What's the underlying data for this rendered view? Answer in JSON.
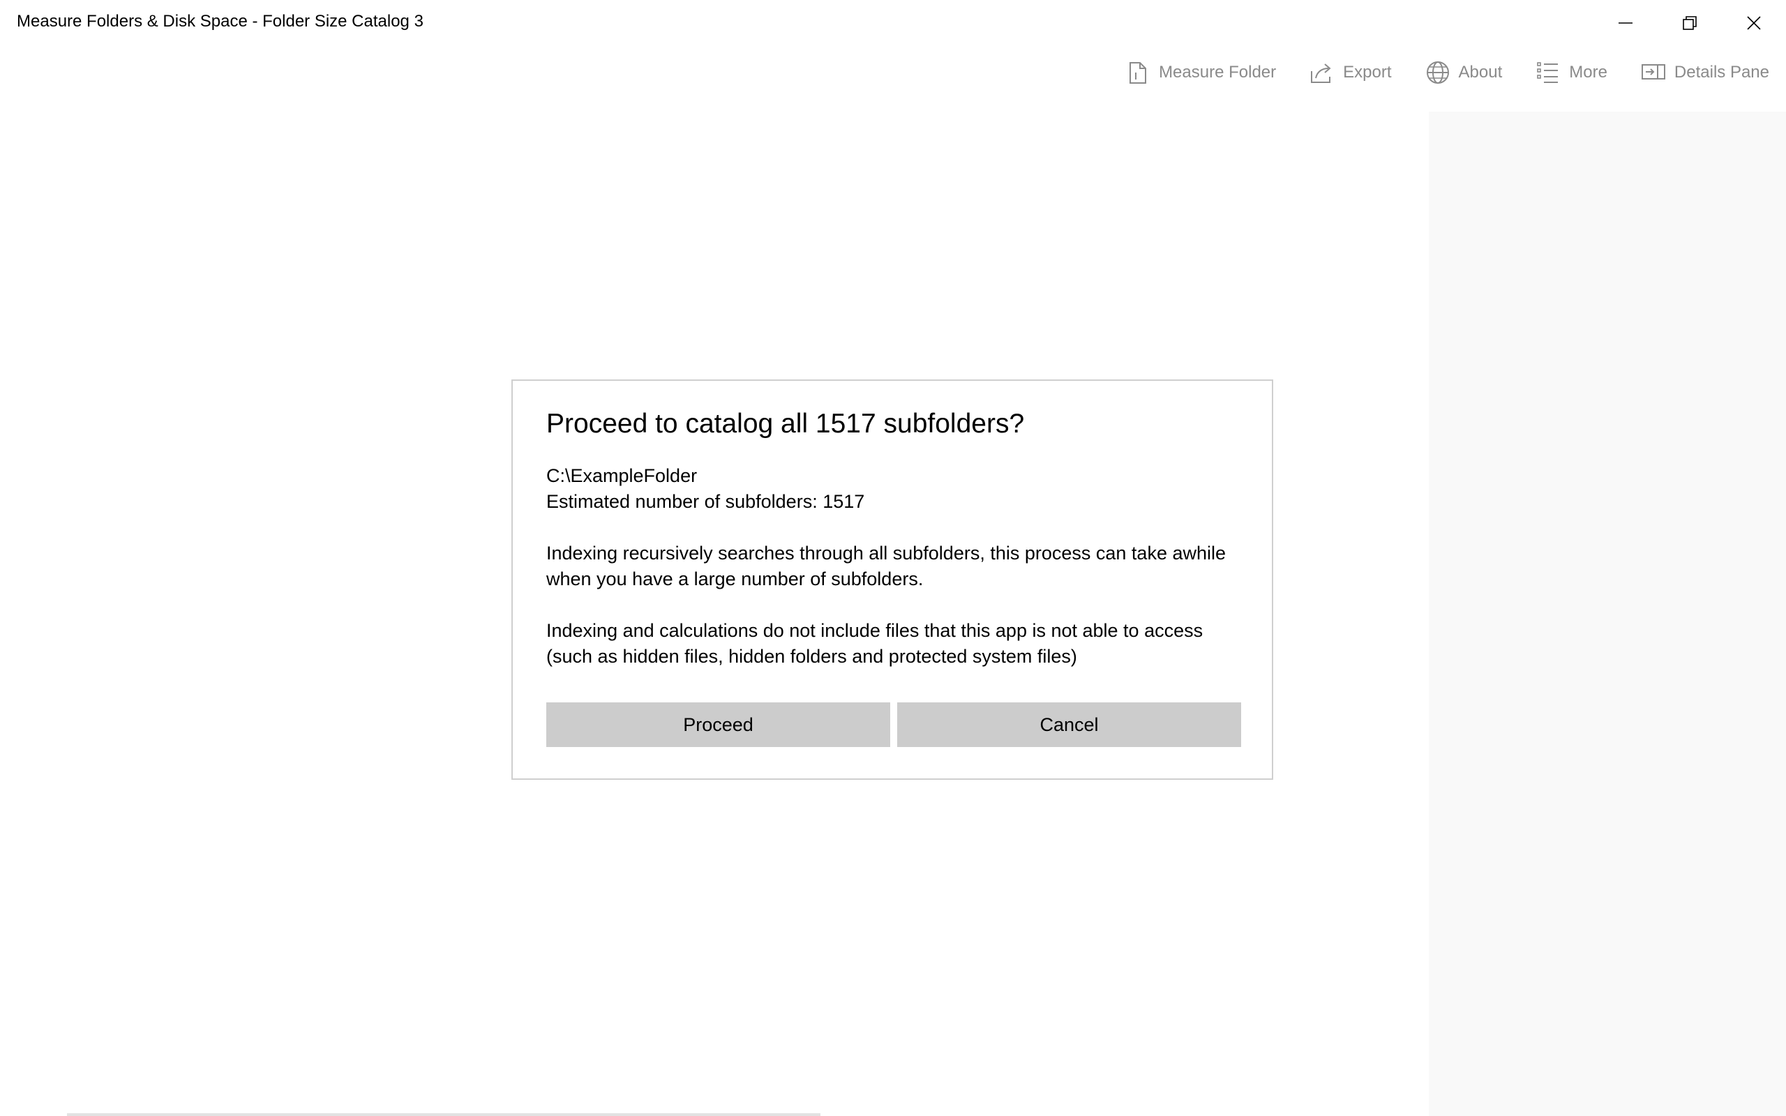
{
  "window": {
    "title": "Measure Folders & Disk Space - Folder Size Catalog 3"
  },
  "caption_buttons": {
    "minimize_icon": "minimize-icon",
    "restore_icon": "restore-icon",
    "close_icon": "close-icon"
  },
  "commandbar": {
    "items": [
      {
        "label": "Measure Folder",
        "icon": "measure-folder-icon"
      },
      {
        "label": "Export",
        "icon": "share-icon"
      },
      {
        "label": "About",
        "icon": "globe-icon"
      },
      {
        "label": "More",
        "icon": "list-icon"
      },
      {
        "label": "Details Pane",
        "icon": "details-pane-icon"
      }
    ]
  },
  "dialog": {
    "title": "Proceed to catalog all 1517 subfolders?",
    "path": "C:\\ExampleFolder",
    "estimate": "Estimated number of subfolders: 1517",
    "paragraph1_line1": "Indexing recursively searches through all subfolders, this process can take awhile",
    "paragraph1_line2": "when you have a large number of subfolders.",
    "paragraph2_line1": "Indexing and calculations do not include files that this app is not able to access",
    "paragraph2_line2": "(such as hidden files, hidden folders and protected system files)",
    "proceed_label": "Proceed",
    "cancel_label": "Cancel"
  },
  "colors": {
    "command_text": "#8a8a8a",
    "button_bg": "#cccccc",
    "details_pane_bg": "#f9f9f9",
    "dialog_border": "#cfcfcf"
  }
}
